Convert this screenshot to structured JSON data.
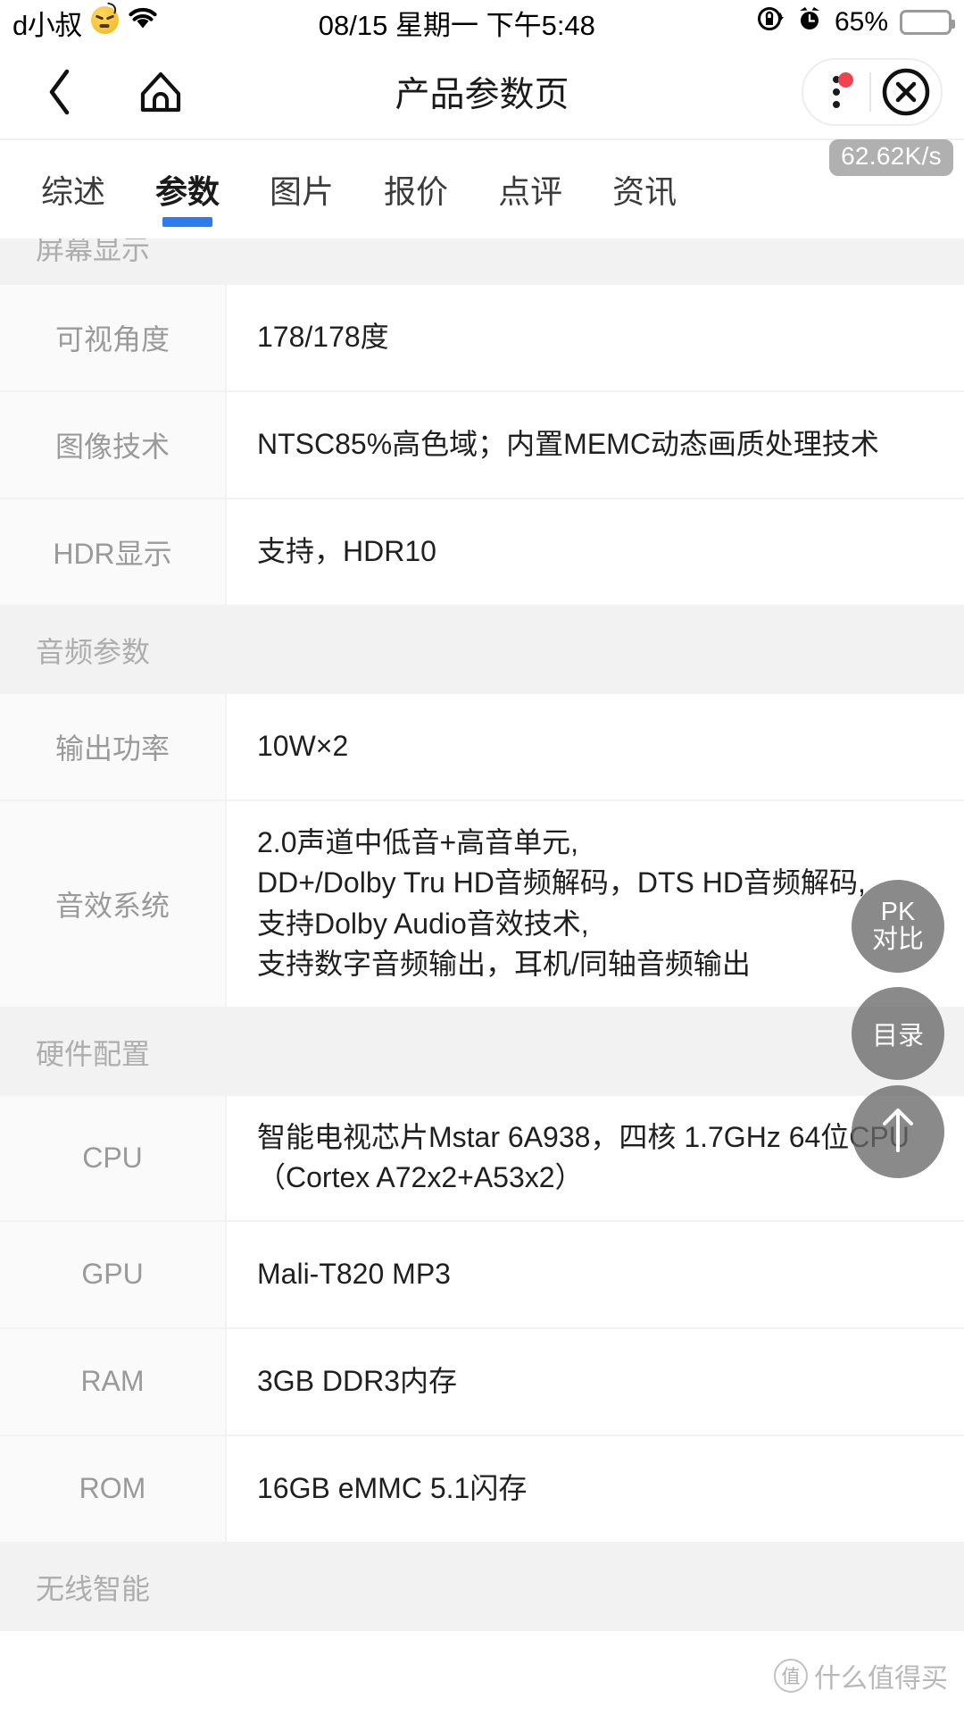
{
  "status_bar": {
    "user": "d小叔",
    "emoji_icon": "angry-face-emoji",
    "wifi_icon": "wifi-icon",
    "datetime": "08/15 星期一 下午5:48",
    "rotation_lock_icon": "rotation-lock-icon",
    "alarm_icon": "alarm-clock-icon",
    "battery_percent": "65%",
    "battery_level": 65
  },
  "navbar": {
    "back_icon": "back-chevron-icon",
    "home_icon": "home-icon",
    "title": "产品参数页",
    "more_icon": "more-vertical-icon",
    "close_icon": "close-circle-icon",
    "network_speed": "62.62K/s"
  },
  "tabs": [
    {
      "label": "综述",
      "active": false
    },
    {
      "label": "参数",
      "active": true
    },
    {
      "label": "图片",
      "active": false
    },
    {
      "label": "报价",
      "active": false
    },
    {
      "label": "点评",
      "active": false
    },
    {
      "label": "资讯",
      "active": false
    }
  ],
  "sections": [
    {
      "title": "屏幕显示",
      "rows": [
        {
          "label": "可视角度",
          "value": "178/178度"
        },
        {
          "label": "图像技术",
          "value": "NTSC85%高色域；内置MEMC动态画质处理技术"
        },
        {
          "label": "HDR显示",
          "value": "支持，HDR10"
        }
      ]
    },
    {
      "title": "音频参数",
      "rows": [
        {
          "label": "输出功率",
          "value": "10W×2"
        },
        {
          "label": "音效系统",
          "value": "2.0声道中低音+高音单元,\nDD+/Dolby Tru HD音频解码，DTS HD音频解码,\n支持Dolby Audio音效技术,\n支持数字音频输出，耳机/同轴音频输出"
        }
      ]
    },
    {
      "title": "硬件配置",
      "rows": [
        {
          "label": "CPU",
          "value": "智能电视芯片Mstar 6A938，四核 1.7GHz 64位CPU（Cortex A72x2+A53x2）"
        },
        {
          "label": "GPU",
          "value": "Mali-T820 MP3"
        },
        {
          "label": "RAM",
          "value": "3GB DDR3内存"
        },
        {
          "label": "ROM",
          "value": "16GB eMMC 5.1闪存"
        }
      ]
    },
    {
      "title": "无线智能",
      "rows": []
    }
  ],
  "fabs": [
    {
      "name": "pk-compare",
      "line1": "PK",
      "line2": "对比"
    },
    {
      "name": "directory",
      "line1": "目录",
      "line2": ""
    },
    {
      "name": "scroll-top",
      "icon": "arrow-up-icon"
    }
  ],
  "watermark": {
    "mark": "值",
    "text": "什么值得买"
  },
  "colors": {
    "accent": "#2a7cf0",
    "badge_red": "#f0424f",
    "battery_yellow": "#fcd450",
    "section_bg": "#f2f2f2",
    "label_bg": "#fafafa"
  }
}
